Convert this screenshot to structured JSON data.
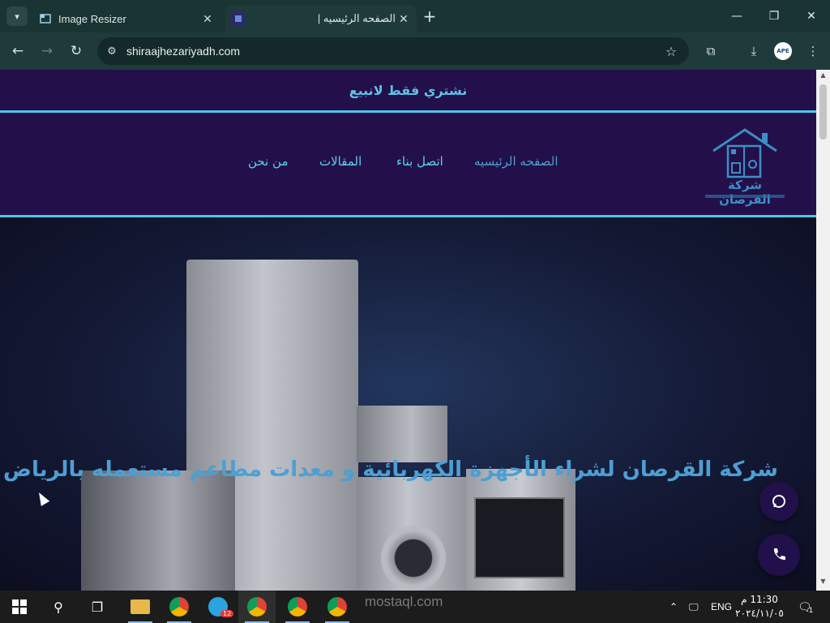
{
  "browser": {
    "tabs": [
      {
        "title": "Image Resizer",
        "active": false
      },
      {
        "title": "الصفحه الرئيسيه |",
        "active": true
      }
    ],
    "url": "shiraajhezariyadh.com"
  },
  "site": {
    "topbar_text": "نشتري فقط لانبيع",
    "nav": [
      "الصفحه الرئيسيه",
      "اتصل بناء",
      "المقالات",
      "من نحن"
    ],
    "logo_text": "شركة القرصان",
    "hero_headline": "شركة القرصان  لشراء الأجهزة الكهربائية و معدات مطاعم مستعمله بالرياض"
  },
  "watermark": "mostaql.com",
  "taskbar": {
    "language": "ENG",
    "time": "11:30 م",
    "date": "٢٠٢٤/١١/٠٥",
    "telegram_badge": "12",
    "notifications": "1"
  },
  "colors": {
    "page_bg": "#23104a",
    "accent_line": "#4ec8e6",
    "nav_text": "#5fd0ef",
    "headline": "#4d9fd3"
  }
}
